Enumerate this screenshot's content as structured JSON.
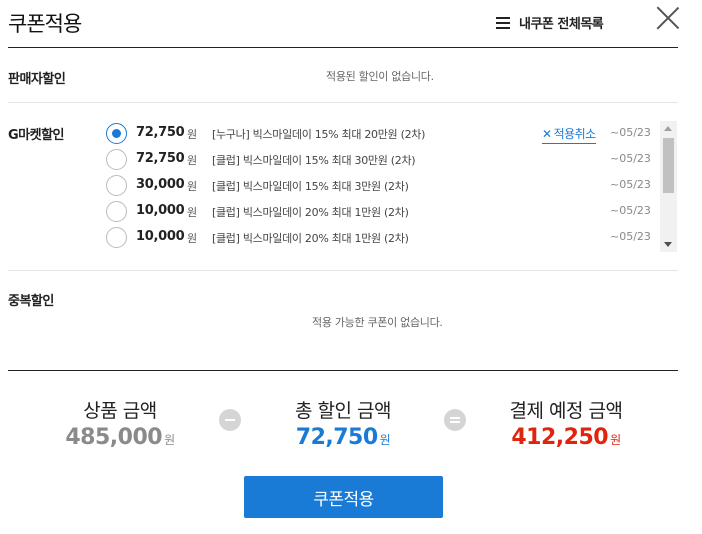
{
  "header": {
    "title": "쿠폰적용",
    "my_coupons_label": "내쿠폰 전체목록"
  },
  "seller_discount": {
    "label": "판매자할인",
    "empty_message": "적용된 할인이 없습니다."
  },
  "gmarket_discount": {
    "label": "G마켓할인",
    "cancel_label": "적용취소",
    "coupons": [
      {
        "amount": "72,750",
        "unit": "원",
        "name": "[누구나] 빅스마일데이 15% 최대 20만원 (2차)",
        "expiry": "~05/23",
        "selected": true
      },
      {
        "amount": "72,750",
        "unit": "원",
        "name": "[클럽] 빅스마일데이 15% 최대 30만원 (2차)",
        "expiry": "~05/23",
        "selected": false
      },
      {
        "amount": "30,000",
        "unit": "원",
        "name": "[클럽] 빅스마일데이 15% 최대 3만원 (2차)",
        "expiry": "~05/23",
        "selected": false
      },
      {
        "amount": "10,000",
        "unit": "원",
        "name": "[클럽] 빅스마일데이 20% 최대 1만원 (2차)",
        "expiry": "~05/23",
        "selected": false
      },
      {
        "amount": "10,000",
        "unit": "원",
        "name": "[클럽] 빅스마일데이 20% 최대 1만원 (2차)",
        "expiry": "~05/23",
        "selected": false
      }
    ]
  },
  "duplicate_discount": {
    "label": "중복할인",
    "empty_message": "적용 가능한 쿠폰이 없습니다."
  },
  "summary": {
    "product": {
      "label": "상품 금액",
      "value": "485,000",
      "unit": "원",
      "color": "#8a8a8a"
    },
    "discount": {
      "label": "총 할인 금액",
      "value": "72,750",
      "unit": "원",
      "color": "#1a7bd6"
    },
    "payment": {
      "label": "결제 예정 금액",
      "value": "412,250",
      "unit": "원",
      "color": "#e0250f"
    }
  },
  "apply_button": "쿠폰적용",
  "colors": {
    "accent": "#1a7bd6",
    "payment": "#e0250f",
    "muted": "#8a8a8a"
  }
}
